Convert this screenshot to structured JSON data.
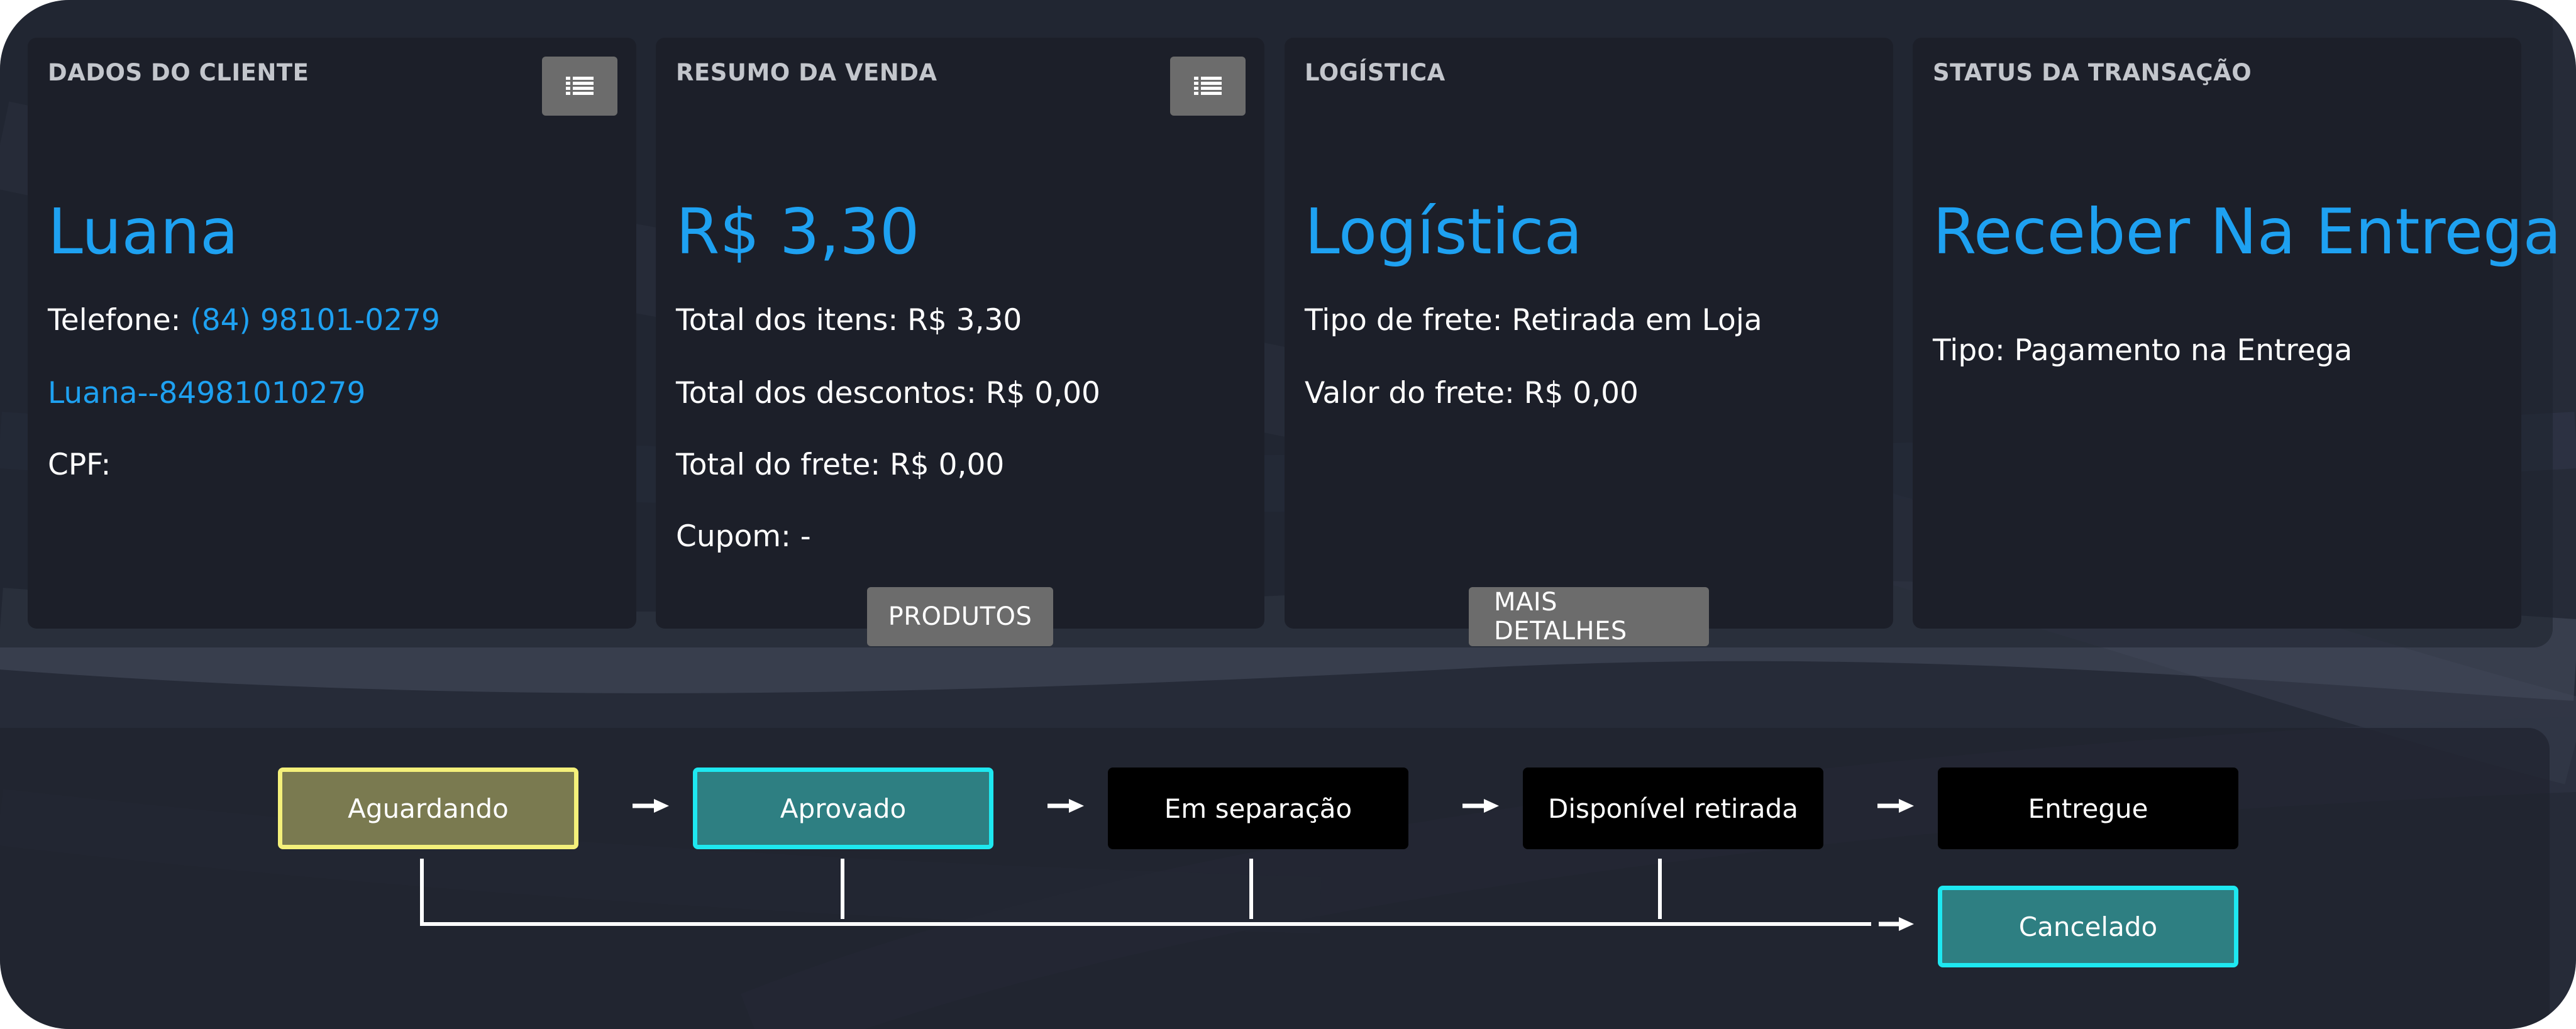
{
  "cards": {
    "cliente": {
      "header": "DADOS DO CLIENTE",
      "name": "Luana",
      "phone_label": "Telefone: ",
      "phone": "(84) 98101-0279",
      "profile_link": "Luana--84981010279",
      "cpf_label": "CPF:"
    },
    "venda": {
      "header": "RESUMO DA VENDA",
      "total": "R$ 3,30",
      "itens": "Total dos itens: R$ 3,30",
      "descontos": "Total dos descontos: R$ 0,00",
      "frete": "Total do frete: R$ 0,00",
      "cupom": "Cupom: -",
      "button_label": "PRODUTOS"
    },
    "logistica": {
      "header": "LOGÍSTICA",
      "title": "Logística",
      "tipo_frete": "Tipo de frete: Retirada em Loja",
      "valor_frete": "Valor do frete: R$ 0,00",
      "button_label": "MAIS DETALHES"
    },
    "status": {
      "header": "STATUS DA TRANSAÇÃO",
      "title": "Receber Na Entrega",
      "tipo": "Tipo: Pagamento na Entrega"
    }
  },
  "icons": {
    "cliente_menu": "list-icon",
    "venda_menu": "list-icon",
    "arrow": "right-arrow-icon"
  },
  "flow": {
    "steps": [
      {
        "label": "Aguardando",
        "state": "current"
      },
      {
        "label": "Aprovado",
        "state": "done"
      },
      {
        "label": "Em separação",
        "state": "pending"
      },
      {
        "label": "Disponível retirada",
        "state": "pending"
      },
      {
        "label": "Entregue",
        "state": "pending"
      }
    ],
    "cancel": {
      "label": "Cancelado",
      "state": "done"
    }
  },
  "colors": {
    "accent_blue": "#1ea1f1",
    "current_fill": "#7a7a50",
    "current_border": "#f4f07a",
    "done_fill": "#2e7f82",
    "done_border": "#1ee8f0",
    "pending_fill": "#000000",
    "button_gray": "#6c6c6c"
  }
}
